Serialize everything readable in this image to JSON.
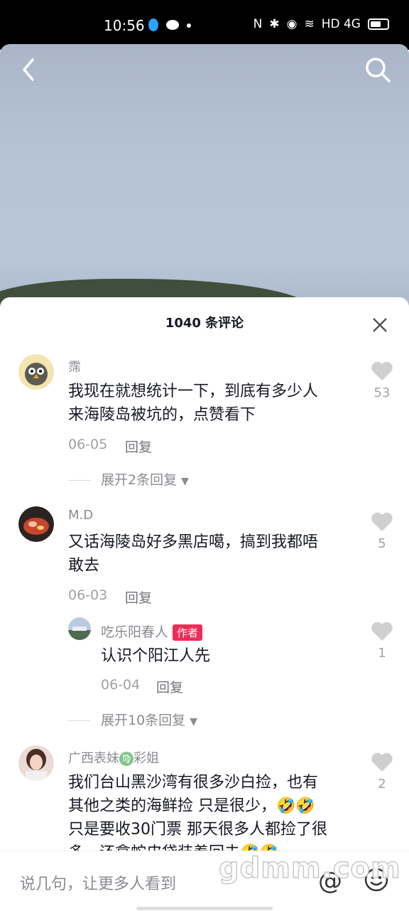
{
  "status_bar": {
    "time": "10:56",
    "network": "HD 4G"
  },
  "comments_sheet": {
    "title": "1040 条评论"
  },
  "comments": [
    {
      "user": "霈",
      "text_line1": "我现在就想统计一下，到底有多少人",
      "text_line2": "来海陵岛被坑的，点赞看下",
      "date": "06-05",
      "reply_label": "回复",
      "likes": "53",
      "expand_label": "展开2条回复"
    },
    {
      "user": "M.D",
      "text_line1": "又话海陵岛好多黑店噶，搞到我都唔",
      "text_line2": "敢去",
      "date": "06-03",
      "reply_label": "回复",
      "likes": "5",
      "expand_label": "展开10条回复",
      "sub_reply": {
        "user": "吃乐阳春人",
        "badge": "作者",
        "text": "认识个阳江人先",
        "date": "06-04",
        "reply_label": "回复",
        "likes": "1"
      }
    },
    {
      "user_part1": "广西表妹",
      "user_part2": "彩姐",
      "text_line1": "我们台山黑沙湾有很多沙白捡，也有",
      "text_line2": "其他之类的海鲜捡 只是很少，🤣🤣",
      "text_line3": "只是要收30门票 那天很多人都捡了很",
      "text_line4": "多，还拿蛇皮袋装着回去🤣🤣",
      "likes": "2"
    }
  ],
  "input": {
    "placeholder": "说几句，让更多人看到"
  },
  "watermark": "gdmm.com",
  "colors": {
    "badge": "#ef2c55",
    "text": "#161823",
    "secondary": "#8a8b91"
  }
}
